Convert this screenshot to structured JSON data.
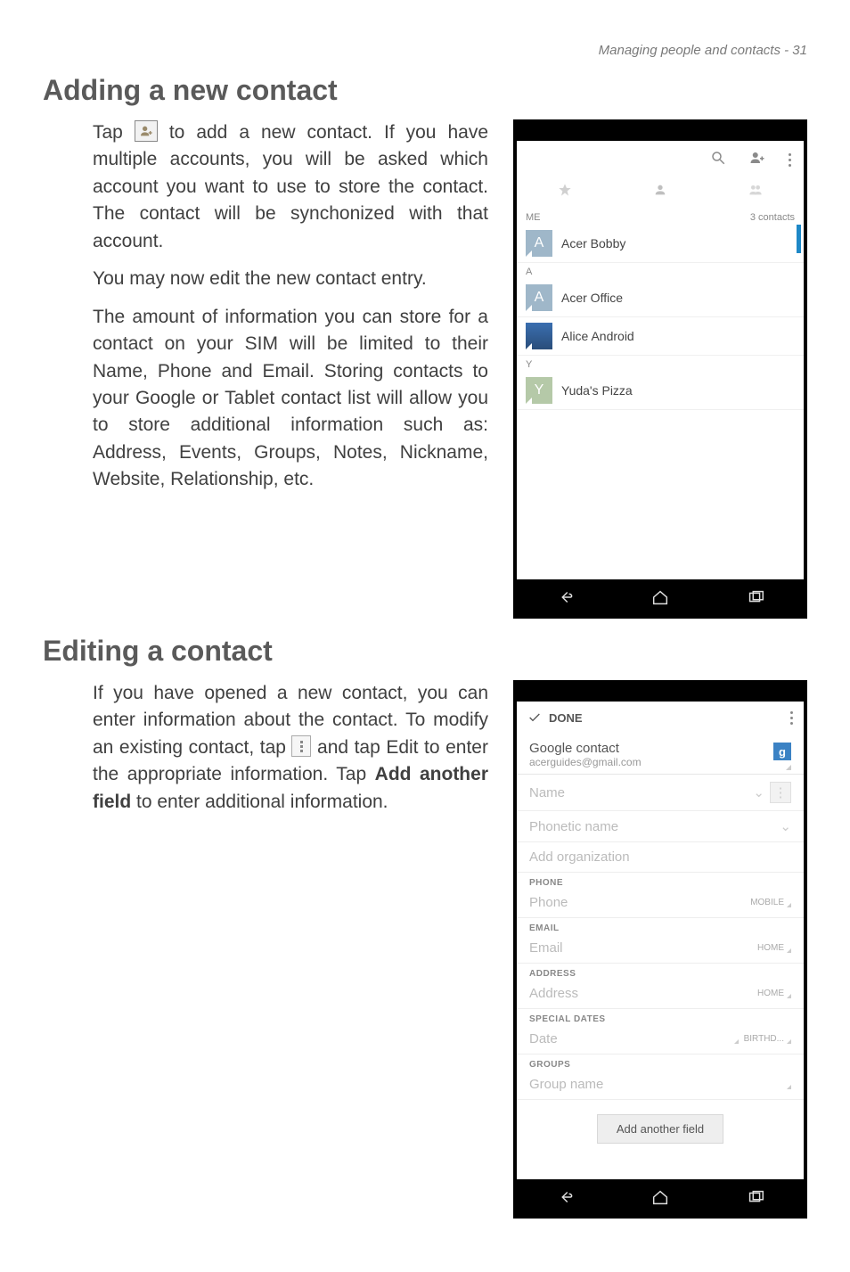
{
  "header": "Managing people and contacts - 31",
  "section1": {
    "title": "Adding a new contact",
    "p1a": "Tap ",
    "p1b": " to add a new contact. If you have multiple accounts, you will be asked which account you want to use to store the contact. The contact will be synchonized with that account.",
    "p2": "You may now edit the new contact entry.",
    "p3": "The amount of information you can store for a contact on your SIM will be limited to their Name, Phone and Email. Storing contacts to your Google or Tablet contact list will allow you to store additional information such as: Address, Events, Groups, Notes, Nickname, Website, Relationship, etc."
  },
  "section2": {
    "title": "Editing a contact",
    "p1a": "If you have opened a new contact, you can enter information about the contact. To modify an existing contact, tap ",
    "p1b": " and tap Edit to enter the appropriate information. Tap ",
    "p1c": "Add another field",
    "p1d": " to enter additional information."
  },
  "phone_contacts": {
    "count": "3 contacts",
    "section_me": "ME",
    "section_a": "A",
    "section_y": "Y",
    "rows": [
      {
        "letter": "A",
        "name": "Acer Bobby"
      },
      {
        "letter": "A",
        "name": "Acer Office"
      },
      {
        "letter": "",
        "name": "Alice Android"
      },
      {
        "letter": "Y",
        "name": "Yuda's Pizza"
      }
    ]
  },
  "phone_edit": {
    "done": "DONE",
    "google": "Google contact",
    "email_account": "acerguides@gmail.com",
    "g": "g",
    "name": "Name",
    "phonetic": "Phonetic name",
    "add_org": "Add organization",
    "labels": {
      "phone_section": "PHONE",
      "email_section": "EMAIL",
      "address_section": "ADDRESS",
      "dates_section": "SPECIAL DATES",
      "groups_section": "GROUPS"
    },
    "fields": {
      "phone": "Phone",
      "phone_type": "MOBILE",
      "email": "Email",
      "email_type": "HOME",
      "address": "Address",
      "address_type": "HOME",
      "date": "Date",
      "date_type": "BIRTHD...",
      "group": "Group name"
    },
    "add_btn": "Add another field"
  }
}
